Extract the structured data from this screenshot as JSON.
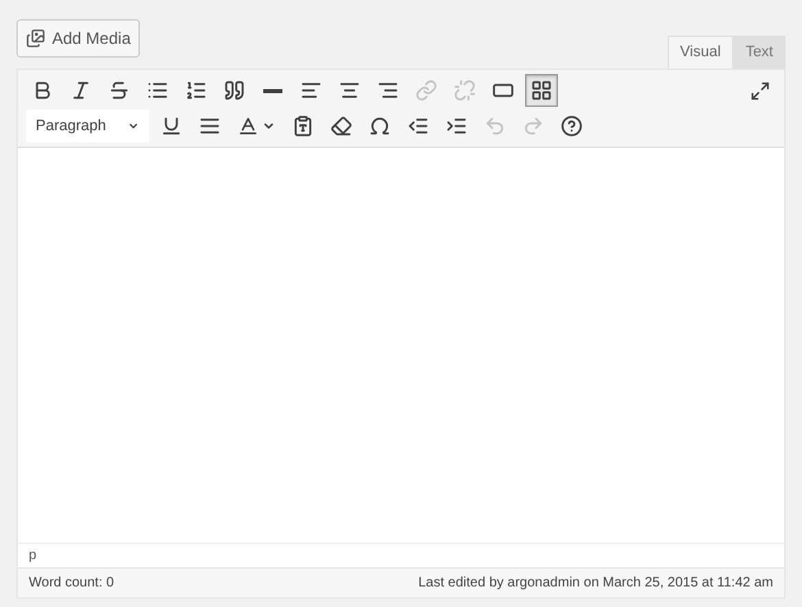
{
  "add_media": {
    "label": "Add Media"
  },
  "tabs": [
    {
      "label": "Visual",
      "selected": true
    },
    {
      "label": "Text",
      "selected": false
    }
  ],
  "toolbar_rows": [
    {
      "items": [
        {
          "kind": "icon",
          "disabled": false,
          "selected": false
        },
        {
          "kind": "icon",
          "disabled": false,
          "selected": false
        },
        {
          "kind": "icon",
          "disabled": false,
          "selected": false
        },
        {
          "kind": "icon",
          "disabled": false,
          "selected": false
        },
        {
          "kind": "icon",
          "disabled": false,
          "selected": false
        },
        {
          "kind": "icon",
          "disabled": false,
          "selected": false
        },
        {
          "kind": "icon",
          "disabled": false,
          "selected": false
        },
        {
          "kind": "icon",
          "disabled": false,
          "selected": false
        },
        {
          "kind": "icon",
          "disabled": false,
          "selected": false
        },
        {
          "kind": "icon",
          "disabled": false,
          "selected": false
        },
        {
          "kind": "icon",
          "disabled": true,
          "selected": false
        },
        {
          "kind": "icon",
          "disabled": true,
          "selected": false
        },
        {
          "kind": "icon",
          "disabled": false,
          "selected": false
        },
        {
          "kind": "icon",
          "disabled": false,
          "selected": true
        }
      ]
    },
    {
      "items": [
        {
          "kind": "select",
          "label": "Paragraph",
          "disabled": false,
          "selected": false
        },
        {
          "kind": "icon",
          "disabled": false,
          "selected": false
        },
        {
          "kind": "icon",
          "disabled": false,
          "selected": false
        },
        {
          "kind": "split",
          "disabled": false,
          "selected": false
        },
        {
          "kind": "icon",
          "disabled": false,
          "selected": false
        },
        {
          "kind": "icon",
          "disabled": false,
          "selected": false
        },
        {
          "kind": "icon",
          "disabled": false,
          "selected": false
        },
        {
          "kind": "icon",
          "disabled": false,
          "selected": false
        },
        {
          "kind": "icon",
          "disabled": false,
          "selected": false
        },
        {
          "kind": "icon",
          "disabled": true,
          "selected": false
        },
        {
          "kind": "icon",
          "disabled": true,
          "selected": false
        },
        {
          "kind": "icon",
          "disabled": false,
          "selected": false
        }
      ]
    }
  ],
  "path": "p",
  "status_bar": {
    "word_count": "Word count: 0",
    "last_edited": "Last edited by argonadmin on March 25, 2015 at 11:42 am"
  }
}
